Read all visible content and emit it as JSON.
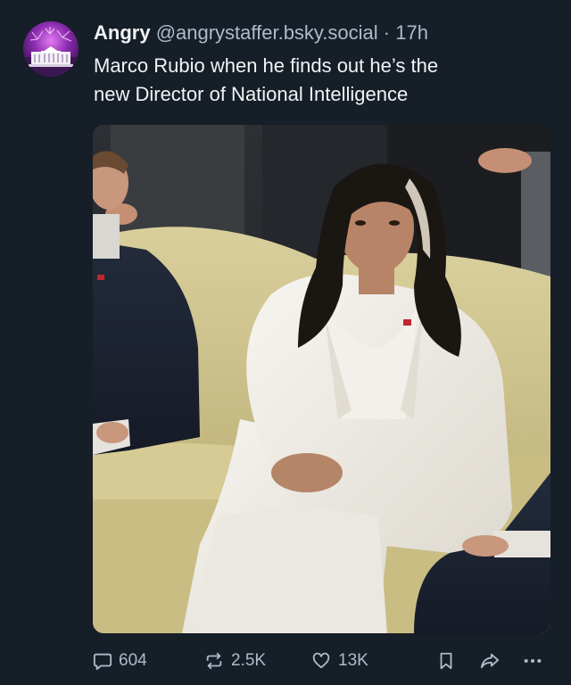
{
  "post": {
    "author": {
      "display_name": "Angry",
      "handle": "@angrystaffer.bsky.social",
      "separator": "·",
      "time": "17h",
      "avatar_icon": "white-house-fireworks-avatar"
    },
    "text_line1": "Marco Rubio when he finds out he’s the",
    "text_line2": "new Director of National Intelligence",
    "media": {
      "kind": "photo"
    },
    "actions": {
      "reply_count": "604",
      "repost_count": "2.5K",
      "like_count": "13K",
      "reply_icon": "speech-bubble-icon",
      "repost_icon": "repost-arrows-icon",
      "like_icon": "heart-icon",
      "bookmark_icon": "bookmark-icon",
      "share_icon": "share-arrow-icon",
      "more_icon": "ellipsis-icon"
    }
  },
  "colors": {
    "background": "#161e27",
    "text_primary": "#f1f3f5",
    "text_secondary": "#aebbc9"
  }
}
